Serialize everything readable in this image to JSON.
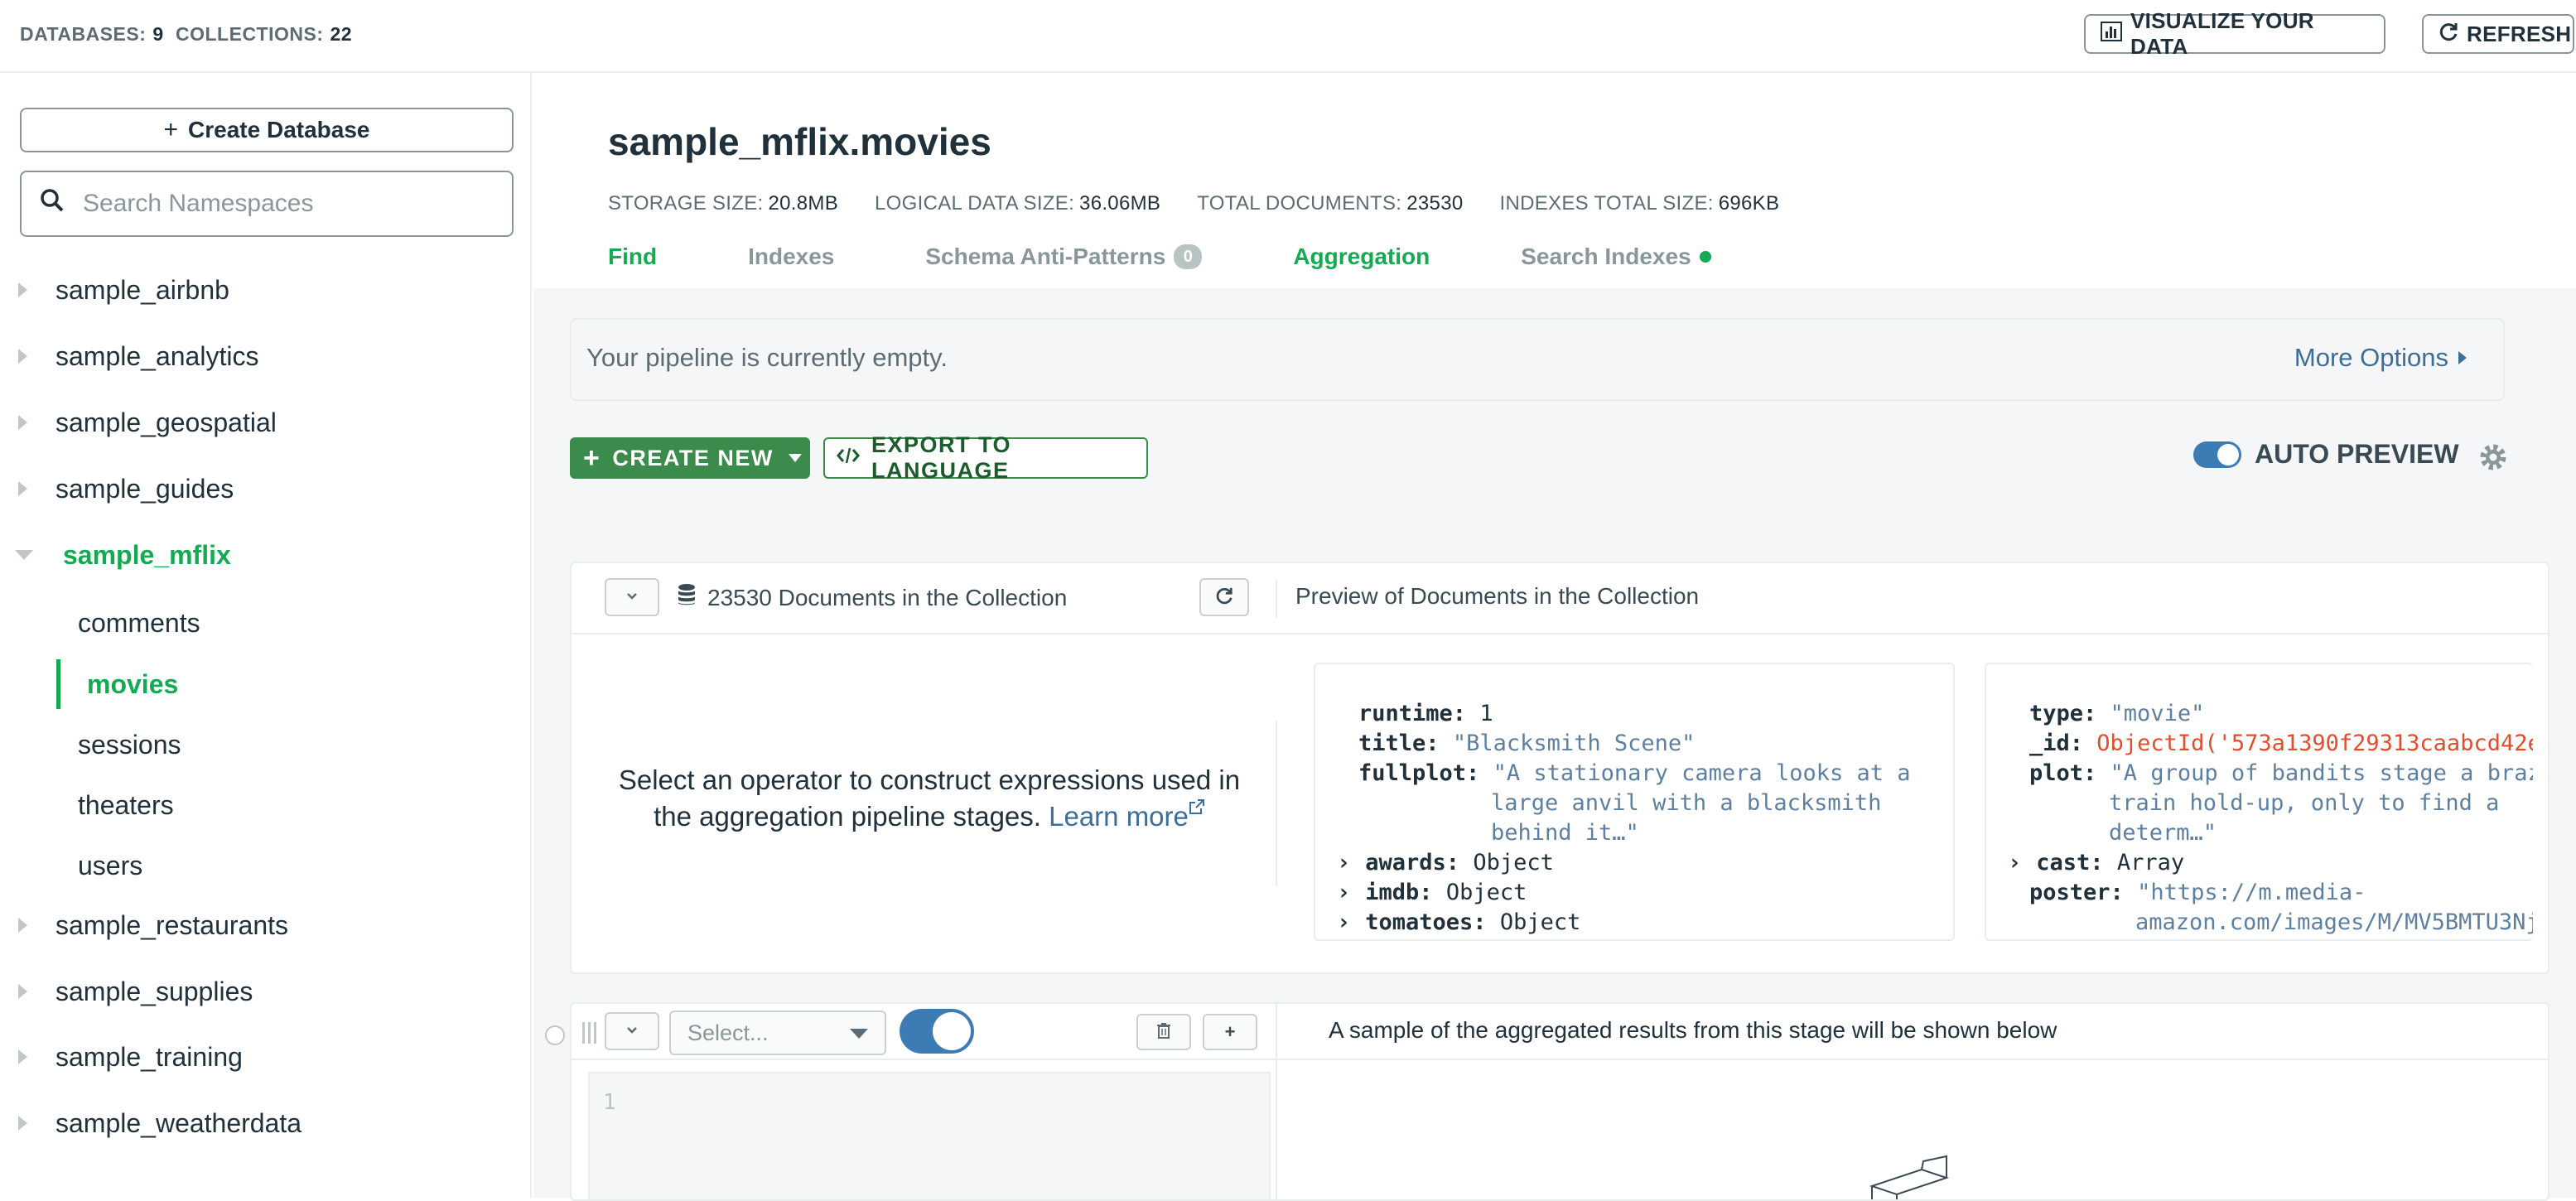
{
  "topbar": {
    "databases_label": "DATABASES:",
    "databases_count": "9",
    "collections_label": "COLLECTIONS:",
    "collections_count": "22",
    "visualize_label": "VISUALIZE YOUR DATA",
    "refresh_label": "REFRESH"
  },
  "sidebar": {
    "create_db_label": "Create Database",
    "search_placeholder": "Search Namespaces",
    "databases": [
      {
        "name": "sample_airbnb"
      },
      {
        "name": "sample_analytics"
      },
      {
        "name": "sample_geospatial"
      },
      {
        "name": "sample_guides"
      },
      {
        "name": "sample_mflix"
      },
      {
        "name": "sample_restaurants"
      },
      {
        "name": "sample_supplies"
      },
      {
        "name": "sample_training"
      },
      {
        "name": "sample_weatherdata"
      }
    ],
    "collections": [
      {
        "name": "comments"
      },
      {
        "name": "movies"
      },
      {
        "name": "sessions"
      },
      {
        "name": "theaters"
      },
      {
        "name": "users"
      }
    ]
  },
  "header": {
    "namespace": "sample_mflix.movies",
    "storage_label": "STORAGE SIZE:",
    "storage_value": "20.8MB",
    "logical_label": "LOGICAL DATA SIZE:",
    "logical_value": "36.06MB",
    "docs_label": "TOTAL DOCUMENTS:",
    "docs_value": "23530",
    "indexes_label": "INDEXES TOTAL SIZE:",
    "indexes_value": "696KB",
    "tabs": [
      {
        "label": "Find"
      },
      {
        "label": "Indexes"
      },
      {
        "label": "Schema Anti-Patterns",
        "badge": "0"
      },
      {
        "label": "Aggregation"
      },
      {
        "label": "Search Indexes"
      }
    ]
  },
  "pipeline": {
    "empty_text": "Your pipeline is currently empty.",
    "more_options": "More Options",
    "create_new": "CREATE NEW",
    "export": "EXPORT TO LANGUAGE",
    "auto_preview": "AUTO PREVIEW"
  },
  "stage_source": {
    "doc_count_text": "23530 Documents in the Collection",
    "preview_label": "Preview of Documents in the Collection",
    "select_text": "Select an operator to construct expressions used in the aggregation pipeline stages.",
    "learn_more": "Learn more",
    "doc1": {
      "runtime_key": "runtime:",
      "runtime_val": "1",
      "title_key": "title:",
      "title_val": "\"Blacksmith Scene\"",
      "fullplot_key": "fullplot:",
      "fullplot_l1": "\"A stationary camera looks at a",
      "fullplot_l2": "large anvil with a blacksmith",
      "fullplot_l3": "behind it…\"",
      "awards_key": "awards:",
      "awards_val": "Object",
      "imdb_key": "imdb:",
      "imdb_val": "Object",
      "tomatoes_key": "tomatoes:",
      "tomatoes_val": "Object"
    },
    "doc2": {
      "type_key": "type:",
      "type_val": "\"movie\"",
      "id_key": "_id:",
      "id_val": "ObjectId('573a1390f29313caabcd42e",
      "plot_key": "plot:",
      "plot_l1": "\"A group of bandits stage a braz",
      "plot_l2": "train hold-up, only to find a",
      "plot_l3": "determ…\"",
      "cast_key": "cast:",
      "cast_val": "Array",
      "poster_key": "poster:",
      "poster_l1": "\"https://m.media-",
      "poster_l2": "amazon.com/images/M/MV5BMTU3Nj"
    }
  },
  "stage_new": {
    "select_placeholder": "Select...",
    "sample_text": "A sample of the aggregated results from this stage will be shown below",
    "line_number": "1"
  },
  "colors": {
    "accent_green": "#13aa52",
    "button_green": "#3b8b4c",
    "link_blue": "#3d6d9a",
    "object_id_red": "#e24d2b"
  }
}
